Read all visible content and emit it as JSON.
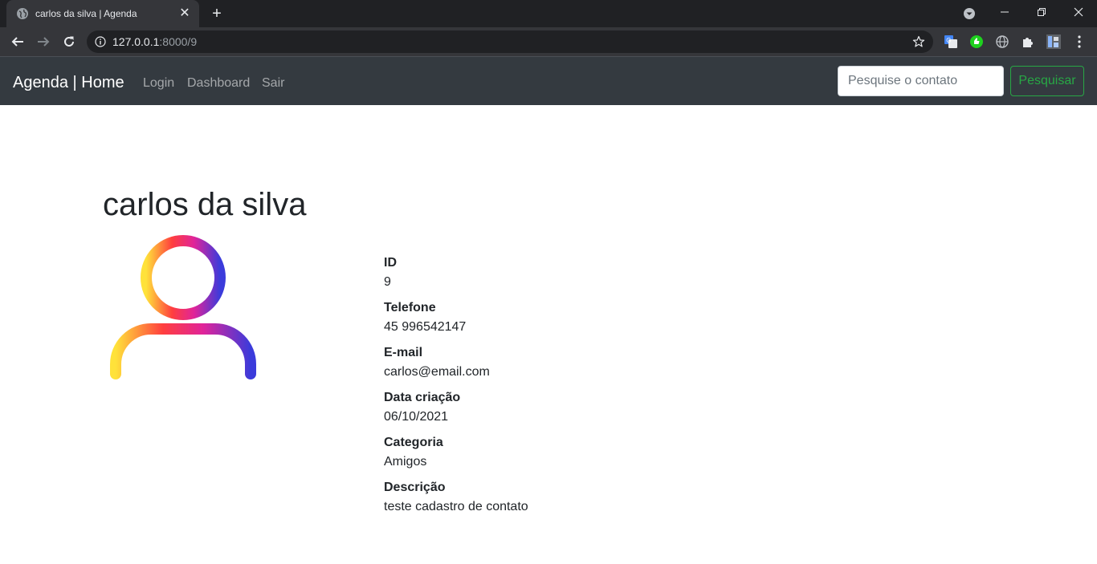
{
  "browser": {
    "tab_title": "carlos da silva | Agenda",
    "url_host": "127.0.0.1",
    "url_rest": ":8000/9"
  },
  "navbar": {
    "brand": "Agenda | Home",
    "links": [
      "Login",
      "Dashboard",
      "Sair"
    ],
    "search_placeholder": "Pesquise o contato",
    "search_button": "Pesquisar"
  },
  "contact": {
    "name": "carlos da silva",
    "fields": [
      {
        "label": "ID",
        "value": "9"
      },
      {
        "label": "Telefone",
        "value": "45 996542147"
      },
      {
        "label": "E-mail",
        "value": "carlos@email.com"
      },
      {
        "label": "Data criação",
        "value": "06/10/2021"
      },
      {
        "label": "Categoria",
        "value": "Amigos"
      },
      {
        "label": "Descrição",
        "value": "teste cadastro de contato"
      }
    ]
  },
  "colors": {
    "navbar_bg": "#343a40",
    "success": "#28a745",
    "avatar_gradient": [
      "#ffe23a",
      "#ff3e3e",
      "#e0249a",
      "#3b3bdb"
    ]
  },
  "icons": {
    "avatar": "user-avatar-icon"
  }
}
